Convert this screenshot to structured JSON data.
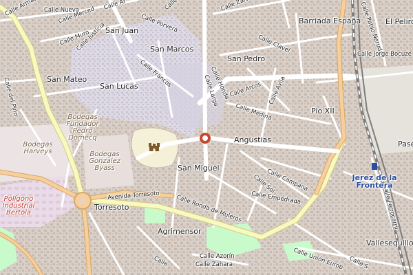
{
  "map": {
    "marker_color": "#c8462f",
    "colors": {
      "background": "#f2efe9",
      "old_town": "#e0dce8",
      "blocks": "#d9d0c9",
      "buildings": "#c7b9ad",
      "primary_road": "#f6cf9a",
      "secondary_road": "#f7fabf",
      "minor_road": "#ffffff",
      "railway": "#7c7c7c",
      "park": "#c8facc",
      "industrial": "#ebdbe8"
    },
    "districts": [
      {
        "label": "San Juan"
      },
      {
        "label": "San Marcos"
      },
      {
        "label": "San Pedro"
      },
      {
        "label": "Barriada España"
      },
      {
        "label": "El Pelirón"
      },
      {
        "label": "San Mateo"
      },
      {
        "label": "San Lucas"
      },
      {
        "label": "Pio XII"
      },
      {
        "label": "Angustias"
      },
      {
        "label": "San Miguel"
      },
      {
        "label": "Torresoto"
      },
      {
        "label": "Agrimensor"
      },
      {
        "label": "Vallesequillo"
      },
      {
        "label": "Paseo"
      }
    ],
    "streets": [
      {
        "label": "Calle Armas de"
      },
      {
        "label": "Calle Nueva"
      },
      {
        "label": "Calle Merced"
      },
      {
        "label": "Calle Ar"
      },
      {
        "label": "Calle Muro"
      },
      {
        "label": "Calle Justicia"
      },
      {
        "label": "Calle Porvera"
      },
      {
        "label": "Calle Gan"
      },
      {
        "label": "Calle Zara"
      },
      {
        "label": "Calle Clavel"
      },
      {
        "label": "Calle Pablo Neruda"
      },
      {
        "label": "Calle Jorge Bocuze"
      },
      {
        "label": "Calle Francos"
      },
      {
        "label": "Calle Larga"
      },
      {
        "label": "Calle Honda"
      },
      {
        "label": "Calle Arcos"
      },
      {
        "label": "Calle Avila"
      },
      {
        "label": "Calle Medina"
      },
      {
        "label": "Calle del Pino"
      },
      {
        "label": "Calle Campana"
      },
      {
        "label": "Calle Sol"
      },
      {
        "label": "Calle Empedrada"
      },
      {
        "label": "Avenida Torresoto"
      },
      {
        "label": "Calle Ronda de Muleros"
      },
      {
        "label": "Calle Ferrocarril"
      },
      {
        "label": "Calle Azorín"
      },
      {
        "label": "Calle Zahara"
      },
      {
        "label": "Calle Unión Europ"
      },
      {
        "label": "Calle"
      },
      {
        "label": "Calle S"
      }
    ],
    "pois": [
      {
        "label": "Bodegas Fundador Pedro Domecq"
      },
      {
        "label": "Bodegas Harveys"
      },
      {
        "label": "Bodegas Gonzalez Byass"
      }
    ],
    "industrial": {
      "label": "Polígono Industrial Bertola"
    },
    "station": {
      "label": "Jerez de la Frontera"
    }
  }
}
